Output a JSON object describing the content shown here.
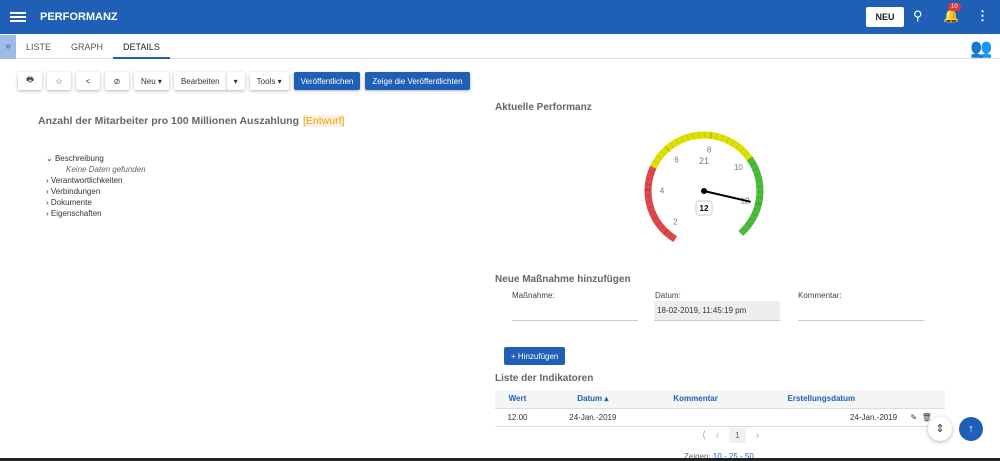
{
  "header": {
    "title": "PERFORMANZ",
    "new_label": "NEU",
    "notification_count": "10"
  },
  "tabs": [
    {
      "label": "LISTE"
    },
    {
      "label": "GRAPH"
    },
    {
      "label": "DETAILS"
    }
  ],
  "toolbar": {
    "neu": "Neu",
    "bearbeiten": "Bearbeiten",
    "tools": "Tools",
    "publish": "Veröffentlichen",
    "show_published": "Zeige die Veröffentlichten"
  },
  "details": {
    "title": "Anzahl der Mitarbeiter pro 100 Millionen Auszahlung",
    "status": "[Entwurf]",
    "tree": {
      "beschreibung": "Beschreibung",
      "empty": "Keine Daten gefunden",
      "verantwortlichkeiten": "Verantwortlichkeiten",
      "verbindungen": "Verbindungen",
      "dokumente": "Dokumente",
      "eigenschaften": "Eigenschaften"
    }
  },
  "performance": {
    "title": "Aktuelle Performanz",
    "gauge_title": "21",
    "value": 12,
    "value_label": "12",
    "min": 1.5,
    "max": 13.5,
    "ticks": [
      "2",
      "4",
      "6",
      "8",
      "10",
      "12"
    ],
    "bands": [
      {
        "to": 5,
        "color": "#e0474c"
      },
      {
        "to": 10,
        "color": "#e0e000"
      },
      {
        "to": 13.5,
        "color": "#4cbb3a"
      }
    ]
  },
  "form": {
    "title": "Neue Maßnahme hinzufügen",
    "massnahme_label": "Maßnahme:",
    "datum_label": "Datum:",
    "datum_value": "18-02-2019, 11:45:19 pm",
    "kommentar_label": "Kommentar:",
    "add_label": "+ Hinzufügen"
  },
  "indicators": {
    "title": "Liste der Indikatoren",
    "headers": [
      "Wert",
      "Datum ▴",
      "Kommentar",
      "Erstellungsdatum"
    ],
    "rows": [
      {
        "wert": "12.00",
        "datum": "24-Jan.-2019",
        "kommentar": "",
        "erstellt": "24-Jan.-2019"
      }
    ],
    "page": "1",
    "show_label": "Zeigen:",
    "page_sizes": "10 - 25 - 50"
  }
}
